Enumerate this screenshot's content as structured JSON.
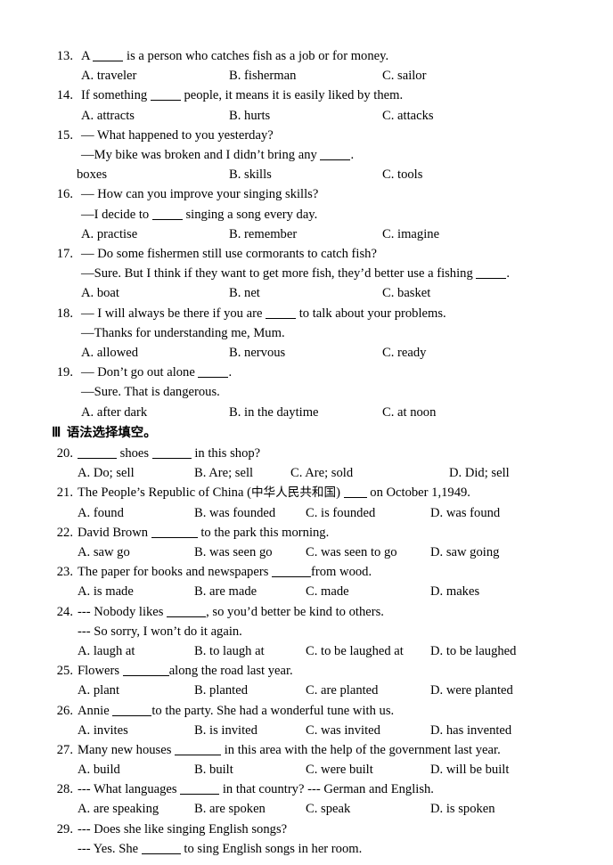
{
  "document": {
    "type": "english-grammar-worksheet",
    "page_background": "#ffffff",
    "text_color": "#000000"
  },
  "section_two": {
    "questions": [
      {
        "number": "13.",
        "stem_pre": "A ",
        "stem_post": " is a person who catches fish as a job or for money.",
        "blank": "medium",
        "options": [
          {
            "label": "A. traveler"
          },
          {
            "label": "B. fisherman"
          },
          {
            "label": "C. sailor"
          }
        ]
      },
      {
        "number": "14.",
        "stem_pre": "If something ",
        "stem_post": " people, it means it is easily liked by them.",
        "blank": "medium",
        "options": [
          {
            "label": "A. attracts"
          },
          {
            "label": "B. hurts"
          },
          {
            "label": "C. attacks"
          }
        ]
      },
      {
        "number": "15.",
        "stem_pre": "— What happened to you yesterday?",
        "stem_post": "",
        "blank": "none",
        "continuation_pre": "—My bike was broken and I didn’t bring any ",
        "continuation_post": ".",
        "continuation_blank": "medium",
        "options": [
          {
            "label": "boxes",
            "stray": true
          },
          {
            "label": "B. skills"
          },
          {
            "label": "C. tools"
          }
        ]
      },
      {
        "number": "16.",
        "stem_pre": "— How can you improve your singing skills?",
        "stem_post": "",
        "blank": "none",
        "continuation_pre": "—I decide to ",
        "continuation_post": " singing a song every day.",
        "continuation_blank": "medium",
        "options": [
          {
            "label": "A. practise"
          },
          {
            "label": "B. remember"
          },
          {
            "label": "C. imagine"
          }
        ]
      },
      {
        "number": "17.",
        "stem_pre": "— Do some fishermen still use cormorants to catch fish?",
        "stem_post": "",
        "blank": "none",
        "continuation_pre": "—Sure. But I think if they want to get more fish, they’d better use a fishing ",
        "continuation_post": ".",
        "continuation_blank": "medium",
        "options": [
          {
            "label": "A. boat"
          },
          {
            "label": "B. net"
          },
          {
            "label": "C. basket"
          }
        ]
      },
      {
        "number": "18.",
        "stem_pre": "— I will always be there if you are ",
        "stem_post": " to talk about your problems.",
        "blank": "medium",
        "continuation_pre": "—Thanks for understanding me, Mum.",
        "continuation_post": "",
        "continuation_blank": "none",
        "options": [
          {
            "label": "A. allowed"
          },
          {
            "label": "B. nervous"
          },
          {
            "label": "C. ready"
          }
        ]
      },
      {
        "number": "19.",
        "stem_pre": "— Don’t go out alone ",
        "stem_post": ".",
        "blank": "medium",
        "continuation_pre": "—Sure. That is dangerous.",
        "continuation_post": "",
        "continuation_blank": "none",
        "options": [
          {
            "label": "A. after dark"
          },
          {
            "label": "B. in the daytime"
          },
          {
            "label": "C. at noon"
          }
        ]
      }
    ]
  },
  "section_three": {
    "heading_roman": "Ⅲ",
    "heading_title": "语法选择填空。",
    "questions": [
      {
        "number": "20.",
        "stem_pre": "",
        "stem_mid": " shoes ",
        "stem_post": " in this shop?",
        "blank": "large",
        "blank2": "large",
        "options": [
          {
            "label": "A. Do; sell"
          },
          {
            "label": "B. Are; sell"
          },
          {
            "label": "C. Are; sold"
          },
          {
            "label": "D. Did; sell"
          }
        ]
      },
      {
        "number": "21.",
        "stem_pre": "The People’s Republic of China (",
        "stem_cn": "中华人民共和国",
        "stem_mid": ") ",
        "stem_post": " on October 1,1949.",
        "blank": "small",
        "options": [
          {
            "label": "A. found"
          },
          {
            "label": "B. was founded"
          },
          {
            "label": "C. is founded"
          },
          {
            "label": "D. was found"
          }
        ]
      },
      {
        "number": "22.",
        "stem_pre": "David Brown ",
        "stem_post": " to the park this morning.",
        "blank": "xlarge",
        "options": [
          {
            "label": "A. saw go"
          },
          {
            "label": "B. was seen go"
          },
          {
            "label": "C. was seen to go"
          },
          {
            "label": "D. saw going"
          }
        ]
      },
      {
        "number": "23.",
        "stem_pre": "The paper for books and newspapers ",
        "stem_post": "from wood.",
        "blank": "large",
        "options": [
          {
            "label": "A. is made"
          },
          {
            "label": "B. are made"
          },
          {
            "label": "C. made"
          },
          {
            "label": "D. makes"
          }
        ]
      },
      {
        "number": "24.",
        "stem_pre": "--- Nobody likes ",
        "stem_post": ", so you’d better be kind to others.",
        "blank": "large",
        "continuation_pre": "--- So sorry, I won’t do it again.",
        "continuation_post": "",
        "continuation_blank": "none",
        "options": [
          {
            "label": "A. laugh at"
          },
          {
            "label": "B. to laugh at"
          },
          {
            "label": "C. to be laughed at"
          },
          {
            "label": "D. to be laughed"
          }
        ]
      },
      {
        "number": "25.",
        "stem_pre": "Flowers ",
        "stem_post": "along the road last year.",
        "blank": "xlarge",
        "options": [
          {
            "label": "A. plant"
          },
          {
            "label": "B. planted"
          },
          {
            "label": "C. are planted"
          },
          {
            "label": "D. were planted"
          }
        ]
      },
      {
        "number": "26.",
        "stem_pre": "Annie ",
        "stem_post": "to the party. She had a wonderful tune with us.",
        "blank": "large",
        "options": [
          {
            "label": "A. invites"
          },
          {
            "label": "B. is invited"
          },
          {
            "label": "C. was invited"
          },
          {
            "label": "D. has invented"
          }
        ]
      },
      {
        "number": "27.",
        "stem_pre": "Many new houses ",
        "stem_post": " in this area with the help of the government last year.",
        "blank": "xlarge",
        "options": [
          {
            "label": "A. build"
          },
          {
            "label": "B. built"
          },
          {
            "label": "C. were built"
          },
          {
            "label": "D. will be built"
          }
        ]
      },
      {
        "number": "28.",
        "stem_pre": "--- What languages ",
        "stem_post": " in that country?    --- German and English.",
        "blank": "large",
        "options": [
          {
            "label": "A. are speaking"
          },
          {
            "label": "B. are spoken"
          },
          {
            "label": "C. speak"
          },
          {
            "label": "D. is spoken"
          }
        ]
      },
      {
        "number": "29.",
        "stem_pre": "--- Does she like singing English songs?",
        "stem_post": "",
        "blank": "none",
        "continuation_pre": "--- Yes. She ",
        "continuation_post": " to sing English songs in her room.",
        "continuation_blank": "large",
        "options": []
      }
    ]
  }
}
